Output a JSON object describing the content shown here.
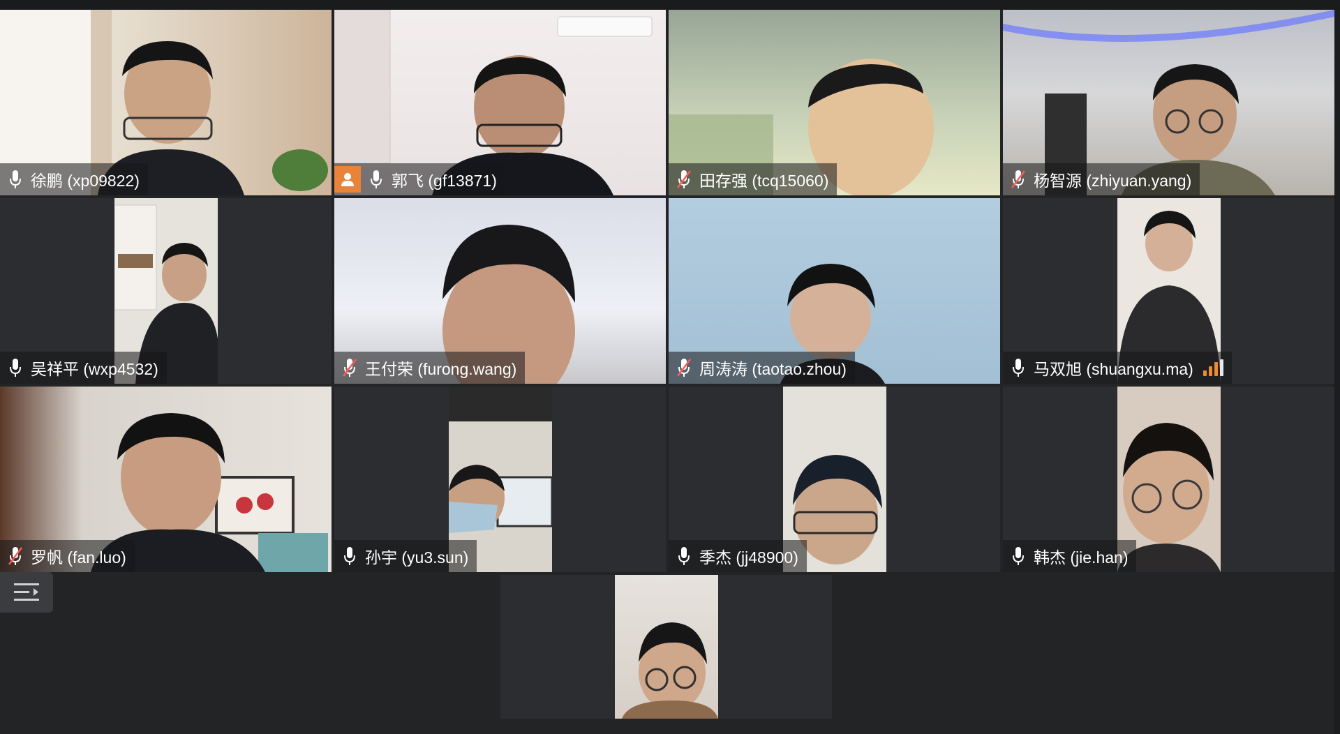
{
  "participants": [
    {
      "name": "徐鹏 (xp09822)",
      "mic": "on"
    },
    {
      "name": "郭飞 (gf13871)",
      "mic": "on",
      "badge": "user-icon"
    },
    {
      "name": "田存强 (tcq15060)",
      "mic": "muted"
    },
    {
      "name": "杨智源 (zhiyuan.yang)",
      "mic": "muted"
    },
    {
      "name": "吴祥平 (wxp4532)",
      "mic": "on"
    },
    {
      "name": "王付荣 (furong.wang)",
      "mic": "muted"
    },
    {
      "name": "周涛涛 (taotao.zhou)",
      "mic": "muted"
    },
    {
      "name": "马双旭 (shuangxu.ma)",
      "mic": "on",
      "speaking_level": 0.75
    },
    {
      "name": "罗帆 (fan.luo)",
      "mic": "muted"
    },
    {
      "name": "孙宇 (yu3.sun)",
      "mic": "on"
    },
    {
      "name": "季杰 (jj48900)",
      "mic": "on"
    },
    {
      "name": "韩杰 (jie.han)",
      "mic": "on"
    }
  ],
  "colors": {
    "background": "#222426",
    "tile": "#2b2d30",
    "badge": "#e8833a",
    "audio_level": "#f08b2a",
    "muted_slash": "#ff5a5a"
  }
}
